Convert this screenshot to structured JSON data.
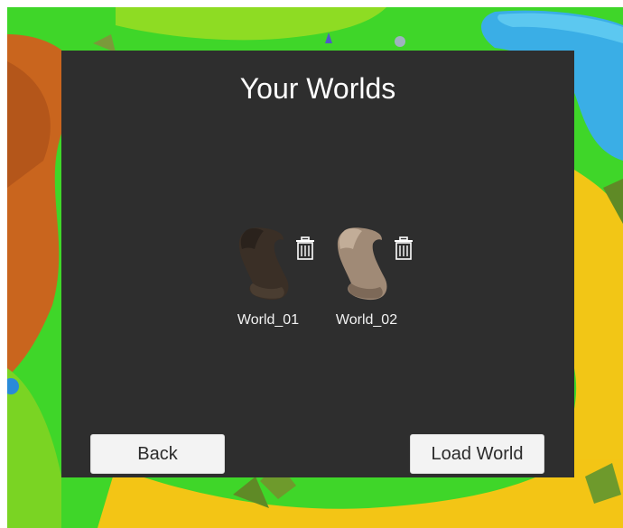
{
  "panel": {
    "title": "Your Worlds"
  },
  "worlds": [
    {
      "name": "World_01",
      "icon": "scroll-icon",
      "delete_icon": "trash-icon",
      "tint": "#3a2f26"
    },
    {
      "name": "World_02",
      "icon": "scroll-icon",
      "delete_icon": "trash-icon",
      "tint": "#a08a76"
    }
  ],
  "buttons": {
    "back_label": "Back",
    "load_label": "Load World"
  },
  "colors": {
    "panel_background": "#2e2e2e",
    "button_background": "#f3f3f3",
    "title_text": "#ffffff"
  }
}
